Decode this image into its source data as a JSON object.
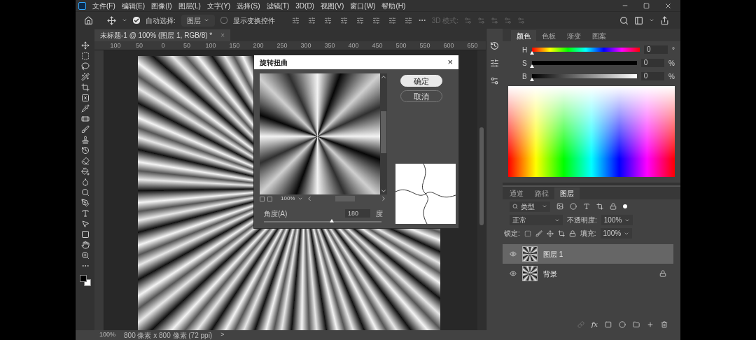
{
  "menu": [
    "文件(F)",
    "编辑(E)",
    "图像(I)",
    "图层(L)",
    "文字(Y)",
    "选择(S)",
    "滤镜(T)",
    "3D(D)",
    "视图(V)",
    "窗口(W)",
    "帮助(H)"
  ],
  "options_bar": {
    "auto_select": {
      "label": "自动选择:",
      "checked": true
    },
    "target": "图层",
    "show_transform": {
      "label": "显示变换控件",
      "checked": false
    },
    "mode_3d": {
      "label": "3D 模式:",
      "disabled": true
    }
  },
  "document_tab": {
    "title": "未标题-1 @ 100% (图层 1, RGB/8) *",
    "close": "×"
  },
  "ruler": [
    "100",
    "50",
    "0",
    "50",
    "100",
    "150",
    "200",
    "250",
    "300",
    "350",
    "400",
    "450",
    "500",
    "550",
    "600",
    "650"
  ],
  "dialog": {
    "title": "旋转扭曲",
    "close": "×",
    "zoom": "100%",
    "angle_label": "角度(A)",
    "angle_value": "180",
    "angle_unit": "度",
    "angle_slider": {
      "level": 0.58
    },
    "buttons": [
      {
        "label": "确定",
        "selected": true
      },
      {
        "label": "取消",
        "selected": false
      }
    ]
  },
  "color_panel": {
    "tabs": [
      {
        "label": "颜色",
        "selected": true
      },
      {
        "label": "色板",
        "selected": false
      },
      {
        "label": "渐变",
        "selected": false
      },
      {
        "label": "图案",
        "selected": false
      }
    ],
    "sliders": [
      {
        "name": "H",
        "value": "0",
        "unit": "°",
        "level": 0
      },
      {
        "name": "S",
        "value": "0",
        "unit": "%",
        "level": 0
      },
      {
        "name": "B",
        "value": "0",
        "unit": "%",
        "level": 0
      }
    ]
  },
  "layers_panel": {
    "tabs": [
      {
        "label": "通道",
        "selected": false
      },
      {
        "label": "路径",
        "selected": false
      },
      {
        "label": "图层",
        "selected": true
      }
    ],
    "filter": "类型",
    "blend_mode": "正常",
    "opacity_label": "不透明度:",
    "opacity": "100%",
    "lock_label": "锁定:",
    "fill_label": "填充:",
    "fill": "100%",
    "layers": [
      {
        "name": "图层 1",
        "selected": true,
        "visible": true,
        "locked": false
      },
      {
        "name": "背景",
        "selected": false,
        "visible": true,
        "locked": true
      }
    ]
  },
  "layer_actions": {
    "effects": "fx"
  },
  "status_bar": {
    "zoom": "100%",
    "size": "800 像素 x 800 像素 (72 ppi)",
    "arrow": ">"
  }
}
